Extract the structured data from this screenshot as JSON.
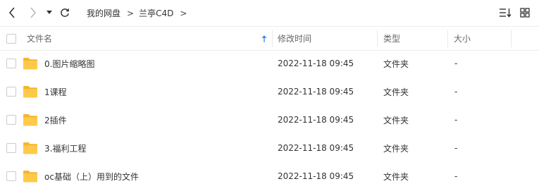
{
  "toolbar": {
    "back_icon": "chevron-left-icon",
    "forward_icon": "chevron-right-icon",
    "dropdown_icon": "caret-down-icon",
    "refresh_icon": "refresh-icon",
    "sort_icon": "sort-icon",
    "grid_icon": "grid-view-icon"
  },
  "breadcrumb": {
    "items": [
      "我的网盘",
      "兰亭C4D"
    ],
    "separator": ">"
  },
  "table": {
    "columns": {
      "name": "文件名",
      "modified": "修改时间",
      "type": "类型",
      "size": "大小"
    },
    "sort_icon": "sort-ascending-arrow-icon",
    "rows": [
      {
        "name": "0.图片缩略图",
        "modified": "2022-11-18 09:45",
        "type": "文件夹",
        "size": "-"
      },
      {
        "name": "1课程",
        "modified": "2022-11-18 09:45",
        "type": "文件夹",
        "size": "-"
      },
      {
        "name": "2插件",
        "modified": "2022-11-18 09:45",
        "type": "文件夹",
        "size": "-"
      },
      {
        "name": "3.福利工程",
        "modified": "2022-11-18 09:45",
        "type": "文件夹",
        "size": "-"
      },
      {
        "name": "oc基础（上）用到的文件",
        "modified": "2022-11-18 09:45",
        "type": "文件夹",
        "size": "-"
      }
    ]
  },
  "colors": {
    "folder": "#ffc94a",
    "folder_dark": "#f5b52b",
    "accent": "#3a8ef0",
    "divider": "#eceef1"
  }
}
